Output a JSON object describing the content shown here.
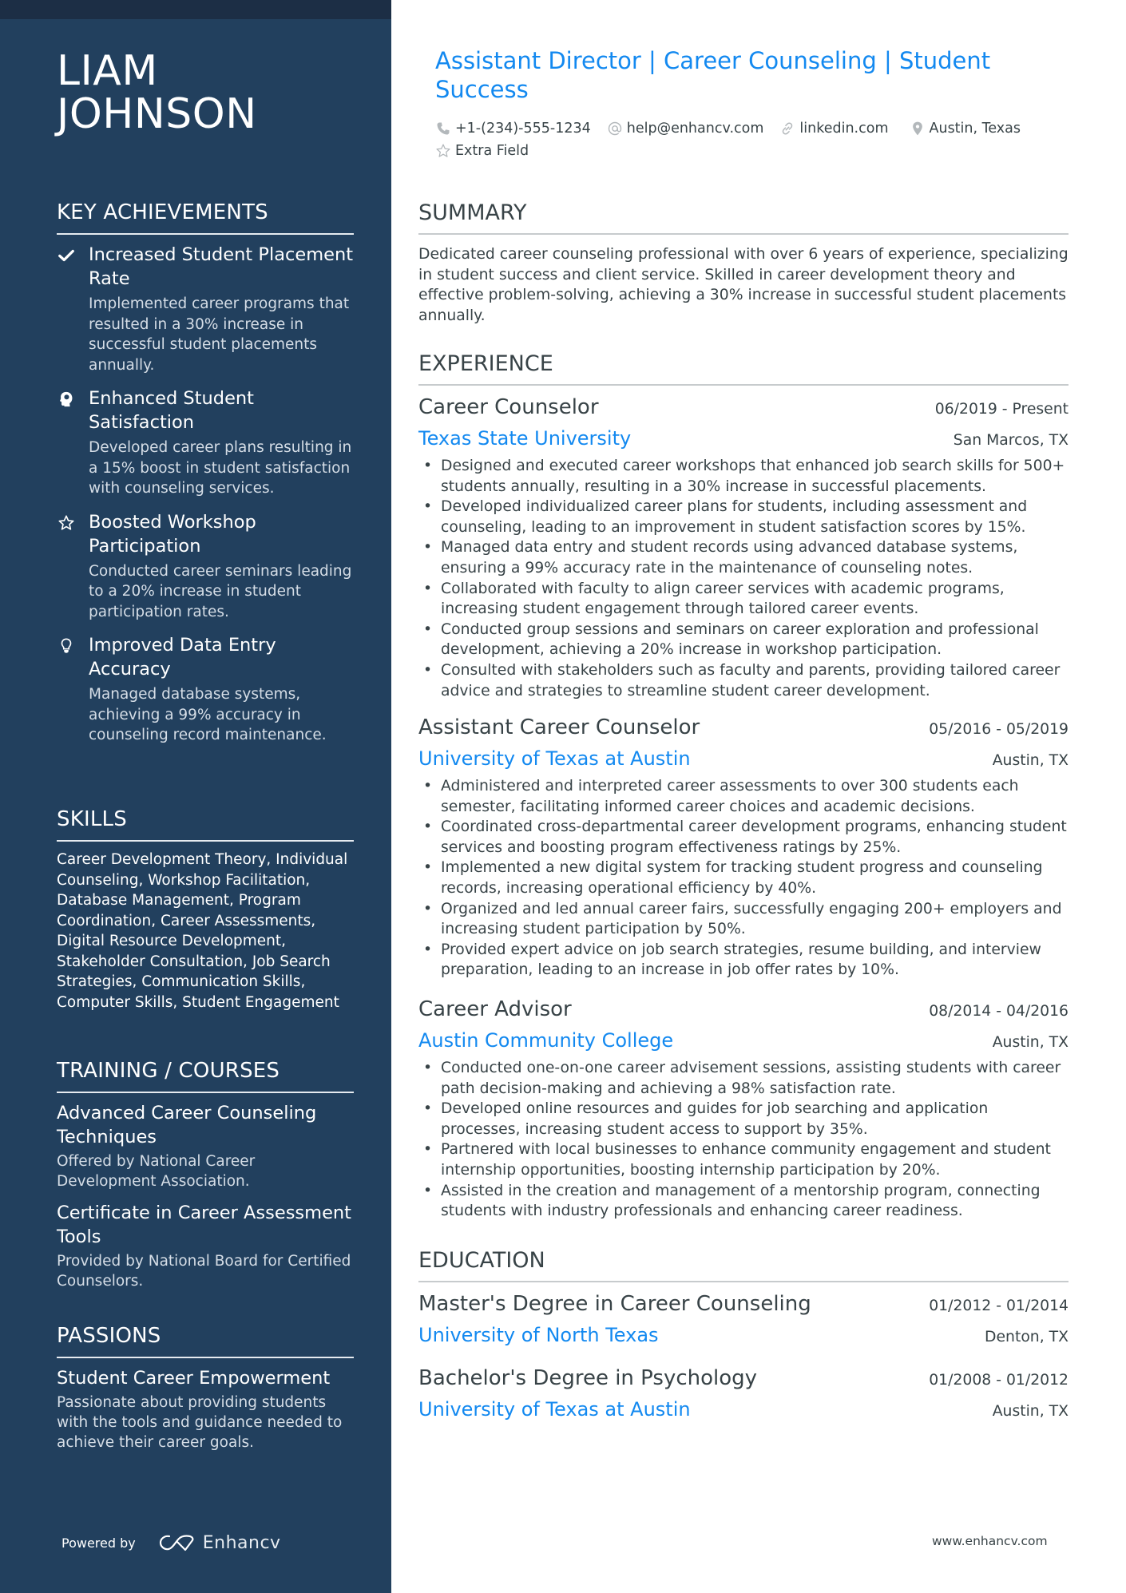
{
  "colors": {
    "sidebar": "#22405e",
    "topbar": "#1c2e45",
    "accent": "#1389f0",
    "text": "#384347",
    "rule": "#c7cbcd"
  },
  "header": {
    "name_line1": "LIAM",
    "name_line2": "JOHNSON",
    "title": "Assistant Director | Career Counseling | Student Success",
    "contacts": [
      {
        "icon": "phone-icon",
        "text": "+1-(234)-555-1234"
      },
      {
        "icon": "at-icon",
        "text": "help@enhancv.com"
      },
      {
        "icon": "link-icon",
        "text": "linkedin.com"
      },
      {
        "icon": "location-pin-icon",
        "text": "Austin, Texas"
      },
      {
        "icon": "star-outline-icon",
        "text": "Extra Field"
      }
    ]
  },
  "sidebar": {
    "achievements": {
      "heading": "KEY ACHIEVEMENTS",
      "items": [
        {
          "icon": "check-icon",
          "title": "Increased Student Placement Rate",
          "desc": "Implemented career programs that resulted in a 30% increase in successful student placements annually."
        },
        {
          "icon": "head-brain-icon",
          "title": "Enhanced Student Satisfaction",
          "desc": "Developed career plans resulting in a 15% boost in student satisfaction with counseling services."
        },
        {
          "icon": "star-outline-icon",
          "title": "Boosted Workshop Participation",
          "desc": "Conducted career seminars leading to a 20% increase in student participation rates."
        },
        {
          "icon": "lightbulb-icon",
          "title": "Improved Data Entry Accuracy",
          "desc": "Managed database systems, achieving a 99% accuracy in counseling record maintenance."
        }
      ]
    },
    "skills": {
      "heading": "SKILLS",
      "text": "Career Development Theory, Individual Counseling, Workshop Facilitation, Database Management, Program Coordination, Career Assessments, Digital Resource Development, Stakeholder Consultation, Job Search Strategies, Communication Skills, Computer Skills, Student Engagement"
    },
    "training": {
      "heading": "TRAINING / COURSES",
      "items": [
        {
          "title": "Advanced Career Counseling Techniques",
          "desc": "Offered by National Career Development Association."
        },
        {
          "title": "Certificate in Career Assessment Tools",
          "desc": "Provided by National Board for Certified Counselors."
        }
      ]
    },
    "passions": {
      "heading": "PASSIONS",
      "items": [
        {
          "title": "Student Career Empowerment",
          "desc": "Passionate about providing students with the tools and guidance needed to achieve their career goals."
        }
      ]
    },
    "footer": {
      "powered_by": "Powered by",
      "brand": "Enhancv"
    }
  },
  "main": {
    "summary": {
      "heading": "SUMMARY",
      "text": "Dedicated career counseling professional with over 6 years of experience, specializing in student success and client service. Skilled in career development theory and effective problem-solving, achieving a 30% increase in successful student placements annually."
    },
    "experience": {
      "heading": "EXPERIENCE",
      "items": [
        {
          "role": "Career Counselor",
          "dates": "06/2019 - Present",
          "org": "Texas State University",
          "location": "San Marcos, TX",
          "bullets": [
            "Designed and executed career workshops that enhanced job search skills for 500+ students annually, resulting in a 30% increase in successful placements.",
            "Developed individualized career plans for students, including assessment and counseling, leading to an improvement in student satisfaction scores by 15%.",
            "Managed data entry and student records using advanced database systems, ensuring a 99% accuracy rate in the maintenance of counseling notes.",
            "Collaborated with faculty to align career services with academic programs, increasing student engagement through tailored career events.",
            "Conducted group sessions and seminars on career exploration and professional development, achieving a 20% increase in workshop participation.",
            "Consulted with stakeholders such as faculty and parents, providing tailored career advice and strategies to streamline student career development."
          ]
        },
        {
          "role": "Assistant Career Counselor",
          "dates": "05/2016 - 05/2019",
          "org": "University of Texas at Austin",
          "location": "Austin, TX",
          "bullets": [
            "Administered and interpreted career assessments to over 300 students each semester, facilitating informed career choices and academic decisions.",
            "Coordinated cross-departmental career development programs, enhancing student services and boosting program effectiveness ratings by 25%.",
            "Implemented a new digital system for tracking student progress and counseling records, increasing operational efficiency by 40%.",
            "Organized and led annual career fairs, successfully engaging 200+ employers and increasing student participation by 50%.",
            "Provided expert advice on job search strategies, resume building, and interview preparation, leading to an increase in job offer rates by 10%."
          ]
        },
        {
          "role": "Career Advisor",
          "dates": "08/2014 - 04/2016",
          "org": "Austin Community College",
          "location": "Austin, TX",
          "bullets": [
            "Conducted one-on-one career advisement sessions, assisting students with career path decision-making and achieving a 98% satisfaction rate.",
            "Developed online resources and guides for job searching and application processes, increasing student access to support by 35%.",
            "Partnered with local businesses to enhance community engagement and student internship opportunities, boosting internship participation by 20%.",
            "Assisted in the creation and management of a mentorship program, connecting students with industry professionals and enhancing career readiness."
          ]
        }
      ]
    },
    "education": {
      "heading": "EDUCATION",
      "items": [
        {
          "degree": "Master's Degree in Career Counseling",
          "dates": "01/2012 - 01/2014",
          "school": "University of North Texas",
          "location": "Denton, TX"
        },
        {
          "degree": "Bachelor's Degree in Psychology",
          "dates": "01/2008 - 01/2012",
          "school": "University of Texas at Austin",
          "location": "Austin, TX"
        }
      ]
    },
    "footer_url": "www.enhancv.com"
  }
}
